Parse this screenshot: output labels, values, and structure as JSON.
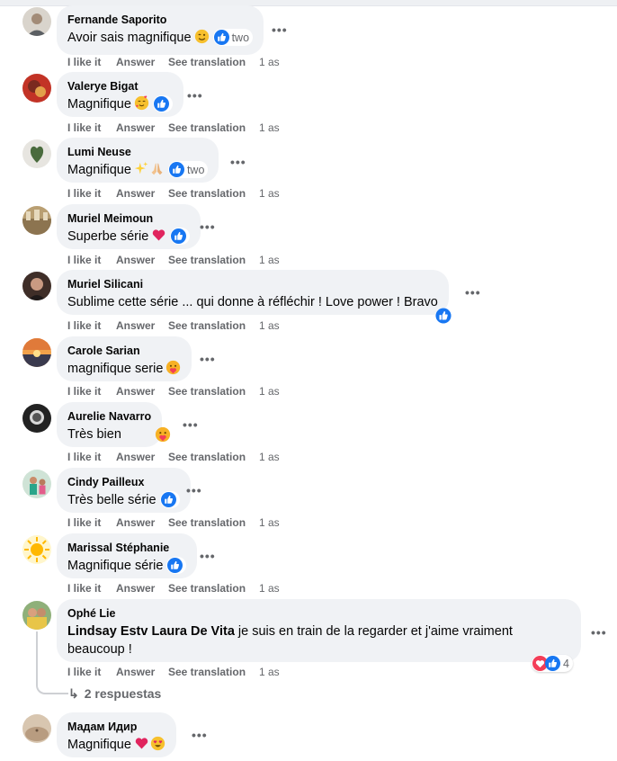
{
  "actions": {
    "like": "I like it",
    "answer": "Answer",
    "translate": "See translation"
  },
  "comments": [
    {
      "author": "Fernande Saporito",
      "text": "Avoir sais magnifique",
      "reaction_count": "two",
      "time": "1 as"
    },
    {
      "author": "Valerye Bigat",
      "text": "Magnifique",
      "time": "1 as"
    },
    {
      "author": "Lumi Neuse",
      "text": "Magnifique",
      "reaction_count": "two",
      "time": "1 as"
    },
    {
      "author": "Muriel Meimoun",
      "text": "Superbe série",
      "time": "1 as"
    },
    {
      "author": "Muriel Silicani",
      "text": "Sublime cette série ... qui donne à réfléchir ! Love power ! Bravo",
      "time": "1 as"
    },
    {
      "author": "Carole Sarian",
      "text": "magnifique serie",
      "time": "1 as"
    },
    {
      "author": "Aurelie Navarro",
      "text": "Très bien",
      "time": "1 as"
    },
    {
      "author": "Cindy Pailleux",
      "text": "Très belle série",
      "time": "1 as"
    },
    {
      "author": "Marissal Stéphanie",
      "text": "Magnifique série",
      "time": "1 as"
    },
    {
      "author": "Ophé Lie",
      "tag": "Lindsay Estv Laura De Vita",
      "text": " je suis en train de la regarder et j'aime vraiment beaucoup !",
      "reaction_count": "4",
      "time": "1 as",
      "replies": "2 respuestas"
    },
    {
      "author": "Мадам Идир",
      "text": "Magnifique"
    }
  ],
  "colors": {
    "like_blue": "#1877f2",
    "bubble": "#f0f2f5",
    "secondary_text": "#65676b",
    "love_red": "#f33e58"
  },
  "icons": {
    "more": "more-horizontal-icon",
    "like": "like-thumb-icon",
    "love": "love-heart-icon",
    "reply": "reply-arrow-icon"
  }
}
